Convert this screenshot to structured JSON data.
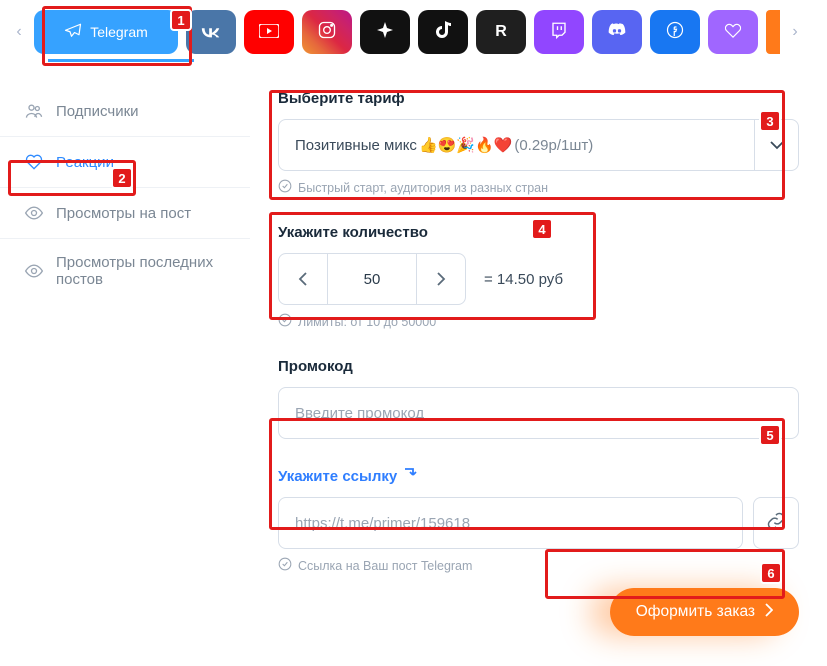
{
  "platforms": {
    "arrow_left": "‹",
    "arrow_right": "›",
    "active": "Telegram"
  },
  "sidebar": {
    "items": [
      {
        "label": "Подписчики"
      },
      {
        "label": "Реакции"
      },
      {
        "label": "Просмотры на пост"
      },
      {
        "label": "Просмотры последних постов"
      }
    ]
  },
  "tariff": {
    "title": "Выберите тариф",
    "value_prefix": "Позитивные микс ",
    "value_suffix": " (0.29р/1шт)",
    "hint": "Быстрый старт, аудитория из разных стран"
  },
  "quantity": {
    "title": "Укажите количество",
    "value": "50",
    "price": "= 14.50 руб",
    "hint": "Лимиты: от 10 до 50000"
  },
  "promo": {
    "title": "Промокод",
    "placeholder": "Введите промокод"
  },
  "link": {
    "title": "Укажите ссылку",
    "placeholder": "https://t.me/primer/159618",
    "hint": "Ссылка на Ваш пост Telegram"
  },
  "submit": {
    "label": "Оформить заказ"
  },
  "annotations": [
    "1",
    "2",
    "3",
    "4",
    "5",
    "6"
  ]
}
